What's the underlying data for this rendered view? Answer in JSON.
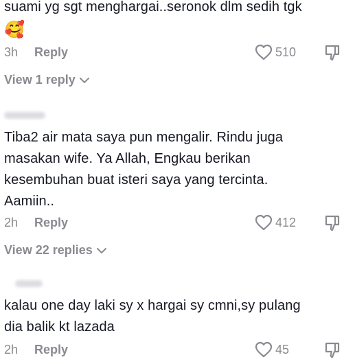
{
  "comments": [
    {
      "text_lines": [
        "suami yg sgt menghargai..seronok dlm sedih tgk"
      ],
      "emoji": "🥰",
      "time": "3h",
      "reply_label": "Reply",
      "likes": "510",
      "view_replies": "View 1 reply"
    },
    {
      "text_lines": [
        "Tiba2 air mata saya pun mengalir. Rindu juga",
        "masakan wife. Ya Allah, Engkau berikan",
        "kesembuhan buat isteri saya yang tercinta.",
        "Aamiin.."
      ],
      "time": "2h",
      "reply_label": "Reply",
      "likes": "412",
      "view_replies": "View 22 replies"
    },
    {
      "text_lines": [
        "kalau one day laki sy x hargai sy cmni,sy pulang",
        "dia balik kt lazada"
      ],
      "time": "2h",
      "reply_label": "Reply",
      "likes": "45"
    }
  ],
  "icons": {
    "like": "heart-outline-icon",
    "dislike": "thumbs-down-icon",
    "expand": "chevron-down-icon"
  },
  "colors": {
    "text": "#161823",
    "muted": "#8a8b91"
  }
}
